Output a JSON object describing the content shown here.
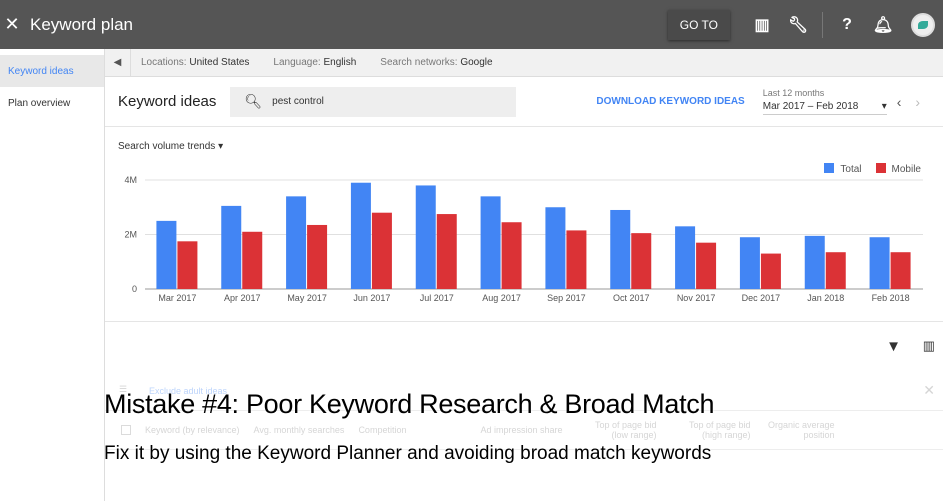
{
  "topbar": {
    "title": "Keyword plan",
    "goto_label": "GO TO"
  },
  "sidebar": {
    "items": [
      {
        "label": "Keyword ideas",
        "active": true
      },
      {
        "label": "Plan overview",
        "active": false
      }
    ]
  },
  "filters": {
    "locations_label": "Locations:",
    "locations_value": "United States",
    "language_label": "Language:",
    "language_value": "English",
    "networks_label": "Search networks:",
    "networks_value": "Google"
  },
  "header": {
    "title": "Keyword ideas",
    "search_value": "pest control",
    "download_label": "DOWNLOAD KEYWORD IDEAS",
    "date_range_label": "Last 12 months",
    "date_range_value": "Mar 2017 – Feb 2018"
  },
  "chart_selector": "Search volume trends",
  "chart_data": {
    "type": "bar",
    "categories": [
      "Mar 2017",
      "Apr 2017",
      "May 2017",
      "Jun 2017",
      "Jul 2017",
      "Aug 2017",
      "Sep 2017",
      "Oct 2017",
      "Nov 2017",
      "Dec 2017",
      "Jan 2018",
      "Feb 2018"
    ],
    "series": [
      {
        "name": "Total",
        "color": "#4285f4",
        "values": [
          2500000,
          3050000,
          3400000,
          3900000,
          3800000,
          3400000,
          3000000,
          2900000,
          2300000,
          1900000,
          1950000,
          1900000
        ]
      },
      {
        "name": "Mobile",
        "color": "#db3236",
        "values": [
          1750000,
          2100000,
          2350000,
          2800000,
          2750000,
          2450000,
          2150000,
          2050000,
          1700000,
          1300000,
          1350000,
          1350000
        ]
      }
    ],
    "y_ticks": [
      "0",
      "2M",
      "4M"
    ],
    "ylim": [
      0,
      4000000
    ],
    "grid": true,
    "legend": "top-right"
  },
  "table": {
    "filter_chip": "Exclude adult ideas",
    "columns": [
      "Keyword (by relevance)",
      "Avg. monthly searches",
      "Competition",
      "Ad impression share",
      "Top of page bid (low range)",
      "Top of page bid (high range)",
      "Organic average position"
    ]
  },
  "overlay": {
    "headline": "Mistake #4: Poor Keyword Research & Broad Match",
    "subline": "Fix it by using the Keyword Planner and avoiding broad match keywords"
  }
}
